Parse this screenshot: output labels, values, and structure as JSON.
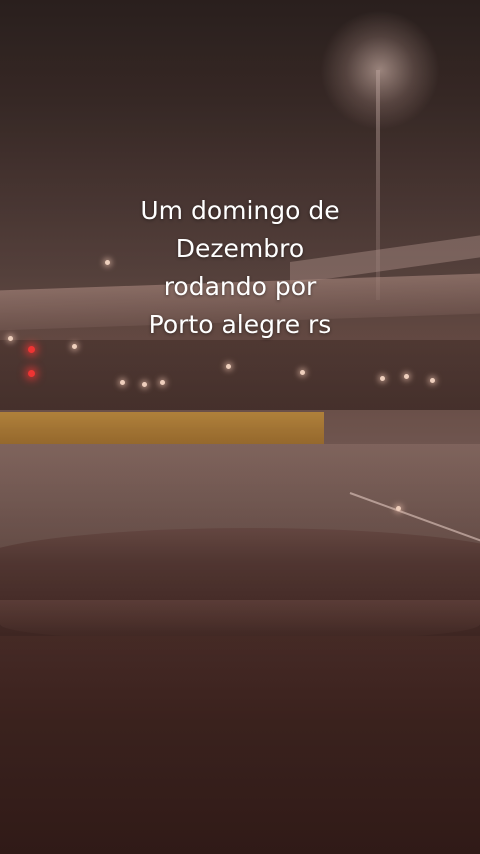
{
  "caption": {
    "lines": [
      "Um domingo de",
      "Dezembro",
      "rodando por",
      "Porto alegre rs"
    ]
  },
  "colors": {
    "text": "#ffffff",
    "barrier": "#c89a40",
    "traffic_light": "#ff3a3a"
  }
}
